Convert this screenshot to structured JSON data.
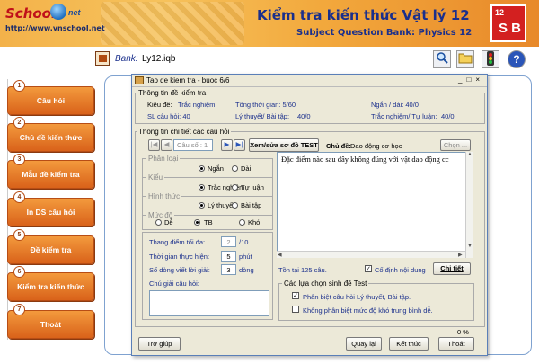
{
  "header": {
    "logo_text": "School",
    "logo_net": "net",
    "url": "http://www.vnschool.net",
    "title": "Kiểm tra kiến thức Vật lý 12",
    "subtitle": "Subject Question Bank: Physics 12",
    "badge_number": "12",
    "badge_letters": "S B"
  },
  "toolbar": {
    "bank_label": "Bank:",
    "bank_value": "Ly12.iqb",
    "icons": [
      "search-icon",
      "folder-icon",
      "traffic-light-icon",
      "help-icon"
    ],
    "help_glyph": "?"
  },
  "menu": [
    {
      "num": "1",
      "label": "Câu hỏi"
    },
    {
      "num": "2",
      "label": "Chủ đề kiến thức"
    },
    {
      "num": "3",
      "label": "Mẫu đề kiểm tra"
    },
    {
      "num": "4",
      "label": "In DS câu hỏi"
    },
    {
      "num": "5",
      "label": "Đề kiểm tra"
    },
    {
      "num": "6",
      "label": "Kiểm tra kiến thức"
    },
    {
      "num": "7",
      "label": "Thoát"
    }
  ],
  "dialog": {
    "title": "Tao de kiem tra - buoc 6/6",
    "info_group": "Thông tin đề kiểm tra",
    "kieu_de_label": "Kiểu đề:",
    "kieu_de_value": "Trắc nghiệm",
    "tong_tg": "Tổng thời gian: 5/60",
    "ngan_dai": "Ngắn / dài: 40/0",
    "sl_cau_hoi": "SL câu hỏi: 40",
    "ly_thuyet_bt": "Lý thuyết/ Bài tập:",
    "ly_thuyet_bt_val": "40/0",
    "tn_tl": "Trắc nghiệm/ Tự luận:",
    "tn_tl_val": "40/0",
    "detail_group": "Thông tin chi tiết các câu hỏi",
    "cau_so": "Câu số : 1",
    "xem_sua_btn": "Xem/sửa sơ đồ TEST",
    "chu_de_label": "Chủ đề:",
    "chu_de_value": "Dao động cơ học",
    "chon_btn": "Chọn ...",
    "phan_loai": "Phân loại",
    "ngan": "Ngắn",
    "dai": "Dài",
    "kieu": "Kiểu",
    "trac_nghiem": "Trắc nghiệm",
    "tu_luan": "Tự luận",
    "hinh_thuc": "Hình thức",
    "ly_thuyet": "Lý thuyết",
    "bai_tap": "Bài tập",
    "muc_do": "Mức độ",
    "de": "Dễ",
    "tb": "TB",
    "kho": "Khó",
    "thang_diem_label": "Thang điểm tối đa:",
    "thang_diem_val": "2",
    "thang_diem_unit": "/10",
    "thoi_gian_label": "Thời gian thực hiện:",
    "thoi_gian_val": "5",
    "thoi_gian_unit": "phút",
    "so_dong_label": "Số dòng viết lời giải:",
    "so_dong_val": "3",
    "so_dong_unit": "dòng",
    "chu_giai_label": "Chú giải câu hỏi:",
    "question_text": "Đặc điểm nào sau đây không đúng với vật dao động cc",
    "ton_tai": "Tồn tại 125 câu.",
    "co_dinh_label": "Cố định nội dung",
    "chi_tiet_btn": "Chi tiết",
    "options_group": "Các lựa chọn sinh đề Test",
    "opt1": "Phân biệt câu hỏi Lý thuyết, Bài tập.",
    "opt2": "Không phân biệt mức độ khó trung bình dễ.",
    "percent": "0 %",
    "tro_giup_btn": "Trợ giúp",
    "quay_lai_btn": "Quay lại",
    "ket_thuc_btn": "Kết thúc",
    "thoat_btn": "Thoát"
  }
}
